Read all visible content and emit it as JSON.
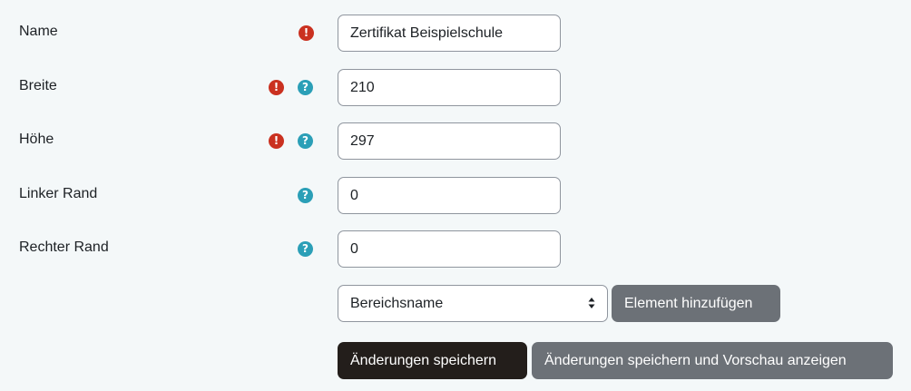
{
  "fields": [
    {
      "label": "Name",
      "value": "Zertifikat Beispielschule",
      "required": true,
      "help": false
    },
    {
      "label": "Breite",
      "value": "210",
      "required": true,
      "help": true
    },
    {
      "label": "Höhe",
      "value": "297",
      "required": true,
      "help": true
    },
    {
      "label": "Linker Rand",
      "value": "0",
      "required": false,
      "help": true
    },
    {
      "label": "Rechter Rand",
      "value": "0",
      "required": false,
      "help": true
    }
  ],
  "icons": {
    "required": "exclamation-circle-icon",
    "help": "question-circle-icon"
  },
  "icon_glyphs": {
    "required": "!",
    "help": "?"
  },
  "region_select": {
    "value": "Bereichsname"
  },
  "buttons": {
    "add_element": "Element hinzufügen",
    "save": "Änderungen speichern",
    "save_preview": "Änderungen speichern und Vorschau anzeigen"
  },
  "colors": {
    "required": "#ca3120",
    "help": "#2b9fb7",
    "primary_button": "#231e1b",
    "secondary_button": "#6c7177"
  }
}
